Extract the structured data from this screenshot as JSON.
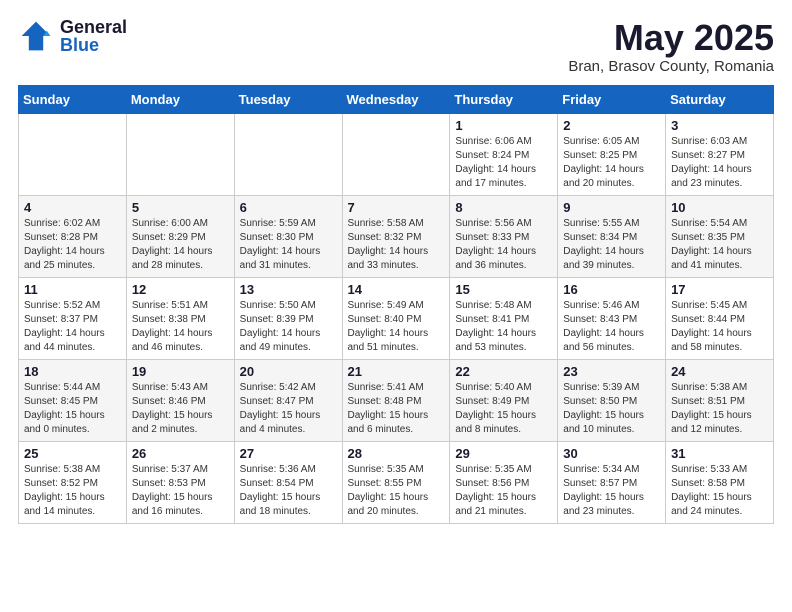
{
  "logo": {
    "general": "General",
    "blue": "Blue"
  },
  "title": "May 2025",
  "subtitle": "Bran, Brasov County, Romania",
  "weekdays": [
    "Sunday",
    "Monday",
    "Tuesday",
    "Wednesday",
    "Thursday",
    "Friday",
    "Saturday"
  ],
  "weeks": [
    [
      {
        "day": "",
        "info": ""
      },
      {
        "day": "",
        "info": ""
      },
      {
        "day": "",
        "info": ""
      },
      {
        "day": "",
        "info": ""
      },
      {
        "day": "1",
        "info": "Sunrise: 6:06 AM\nSunset: 8:24 PM\nDaylight: 14 hours\nand 17 minutes."
      },
      {
        "day": "2",
        "info": "Sunrise: 6:05 AM\nSunset: 8:25 PM\nDaylight: 14 hours\nand 20 minutes."
      },
      {
        "day": "3",
        "info": "Sunrise: 6:03 AM\nSunset: 8:27 PM\nDaylight: 14 hours\nand 23 minutes."
      }
    ],
    [
      {
        "day": "4",
        "info": "Sunrise: 6:02 AM\nSunset: 8:28 PM\nDaylight: 14 hours\nand 25 minutes."
      },
      {
        "day": "5",
        "info": "Sunrise: 6:00 AM\nSunset: 8:29 PM\nDaylight: 14 hours\nand 28 minutes."
      },
      {
        "day": "6",
        "info": "Sunrise: 5:59 AM\nSunset: 8:30 PM\nDaylight: 14 hours\nand 31 minutes."
      },
      {
        "day": "7",
        "info": "Sunrise: 5:58 AM\nSunset: 8:32 PM\nDaylight: 14 hours\nand 33 minutes."
      },
      {
        "day": "8",
        "info": "Sunrise: 5:56 AM\nSunset: 8:33 PM\nDaylight: 14 hours\nand 36 minutes."
      },
      {
        "day": "9",
        "info": "Sunrise: 5:55 AM\nSunset: 8:34 PM\nDaylight: 14 hours\nand 39 minutes."
      },
      {
        "day": "10",
        "info": "Sunrise: 5:54 AM\nSunset: 8:35 PM\nDaylight: 14 hours\nand 41 minutes."
      }
    ],
    [
      {
        "day": "11",
        "info": "Sunrise: 5:52 AM\nSunset: 8:37 PM\nDaylight: 14 hours\nand 44 minutes."
      },
      {
        "day": "12",
        "info": "Sunrise: 5:51 AM\nSunset: 8:38 PM\nDaylight: 14 hours\nand 46 minutes."
      },
      {
        "day": "13",
        "info": "Sunrise: 5:50 AM\nSunset: 8:39 PM\nDaylight: 14 hours\nand 49 minutes."
      },
      {
        "day": "14",
        "info": "Sunrise: 5:49 AM\nSunset: 8:40 PM\nDaylight: 14 hours\nand 51 minutes."
      },
      {
        "day": "15",
        "info": "Sunrise: 5:48 AM\nSunset: 8:41 PM\nDaylight: 14 hours\nand 53 minutes."
      },
      {
        "day": "16",
        "info": "Sunrise: 5:46 AM\nSunset: 8:43 PM\nDaylight: 14 hours\nand 56 minutes."
      },
      {
        "day": "17",
        "info": "Sunrise: 5:45 AM\nSunset: 8:44 PM\nDaylight: 14 hours\nand 58 minutes."
      }
    ],
    [
      {
        "day": "18",
        "info": "Sunrise: 5:44 AM\nSunset: 8:45 PM\nDaylight: 15 hours\nand 0 minutes."
      },
      {
        "day": "19",
        "info": "Sunrise: 5:43 AM\nSunset: 8:46 PM\nDaylight: 15 hours\nand 2 minutes."
      },
      {
        "day": "20",
        "info": "Sunrise: 5:42 AM\nSunset: 8:47 PM\nDaylight: 15 hours\nand 4 minutes."
      },
      {
        "day": "21",
        "info": "Sunrise: 5:41 AM\nSunset: 8:48 PM\nDaylight: 15 hours\nand 6 minutes."
      },
      {
        "day": "22",
        "info": "Sunrise: 5:40 AM\nSunset: 8:49 PM\nDaylight: 15 hours\nand 8 minutes."
      },
      {
        "day": "23",
        "info": "Sunrise: 5:39 AM\nSunset: 8:50 PM\nDaylight: 15 hours\nand 10 minutes."
      },
      {
        "day": "24",
        "info": "Sunrise: 5:38 AM\nSunset: 8:51 PM\nDaylight: 15 hours\nand 12 minutes."
      }
    ],
    [
      {
        "day": "25",
        "info": "Sunrise: 5:38 AM\nSunset: 8:52 PM\nDaylight: 15 hours\nand 14 minutes."
      },
      {
        "day": "26",
        "info": "Sunrise: 5:37 AM\nSunset: 8:53 PM\nDaylight: 15 hours\nand 16 minutes."
      },
      {
        "day": "27",
        "info": "Sunrise: 5:36 AM\nSunset: 8:54 PM\nDaylight: 15 hours\nand 18 minutes."
      },
      {
        "day": "28",
        "info": "Sunrise: 5:35 AM\nSunset: 8:55 PM\nDaylight: 15 hours\nand 20 minutes."
      },
      {
        "day": "29",
        "info": "Sunrise: 5:35 AM\nSunset: 8:56 PM\nDaylight: 15 hours\nand 21 minutes."
      },
      {
        "day": "30",
        "info": "Sunrise: 5:34 AM\nSunset: 8:57 PM\nDaylight: 15 hours\nand 23 minutes."
      },
      {
        "day": "31",
        "info": "Sunrise: 5:33 AM\nSunset: 8:58 PM\nDaylight: 15 hours\nand 24 minutes."
      }
    ]
  ]
}
